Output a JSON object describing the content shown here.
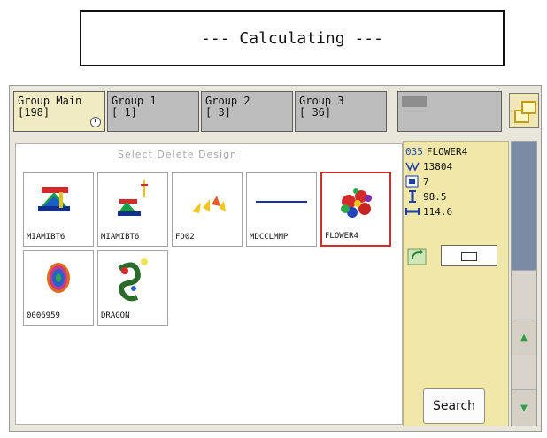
{
  "status": {
    "calculating_text": "--- Calculating ---"
  },
  "tabs": [
    {
      "label": "Group Main",
      "sub": "[198]"
    },
    {
      "label": "Group 1",
      "sub": "[ 1]"
    },
    {
      "label": "Group 2",
      "sub": "[ 3]"
    },
    {
      "label": "Group 3",
      "sub": "[ 36]"
    },
    {
      "label": "",
      "sub": ""
    }
  ],
  "design_area": {
    "title": "Select Delete Design"
  },
  "designs": [
    {
      "name": "MIAMIBT6"
    },
    {
      "name": "MIAMIBT6"
    },
    {
      "name": "FD02"
    },
    {
      "name": "MDCCLMMP"
    },
    {
      "name": "FLOWER4",
      "selected": true
    },
    {
      "name": "0006959"
    },
    {
      "name": "DRAGON"
    }
  ],
  "info": {
    "number": "035",
    "name": "FLOWER4",
    "stitches": "13804",
    "colors": "7",
    "height": "98.5",
    "width": "114.6"
  },
  "buttons": {
    "search": "Search"
  },
  "colors": {
    "active_tab": "#f1ebc4",
    "info_panel": "#f1e7a8",
    "selected_border": "#d22d2d",
    "scroll_track": "#7b8aa5",
    "arrow": "#2aa244"
  }
}
